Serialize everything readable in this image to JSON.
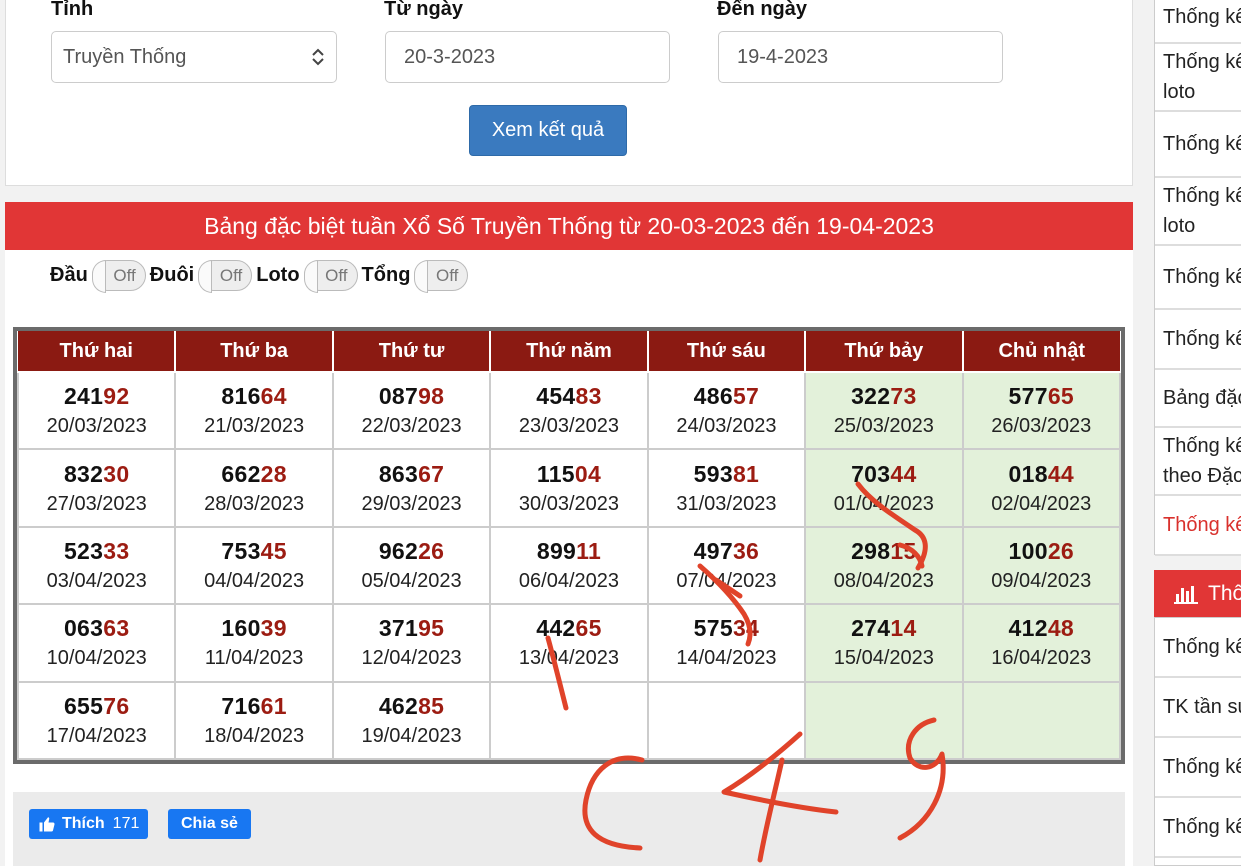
{
  "filter": {
    "province_label": "Tỉnh",
    "province_value": "Truyền Thống",
    "from_label": "Từ ngày",
    "from_value": "20-3-2023",
    "to_label": "Đến ngày",
    "to_value": "19-4-2023",
    "submit_label": "Xem kết quả"
  },
  "panel": {
    "title": "Bảng đặc biệt tuần Xổ Số Truyền Thống từ 20-03-2023 đến 19-04-2023",
    "toggles": [
      {
        "label": "Đầu",
        "state": "Off"
      },
      {
        "label": "Đuôi",
        "state": "Off"
      },
      {
        "label": "Loto",
        "state": "Off"
      },
      {
        "label": "Tổng",
        "state": "Off"
      }
    ]
  },
  "table": {
    "headers": [
      "Thứ hai",
      "Thứ ba",
      "Thứ tư",
      "Thứ năm",
      "Thứ sáu",
      "Thứ bảy",
      "Chủ nhật"
    ],
    "rows": [
      [
        [
          "241",
          "92",
          "20/03/2023"
        ],
        [
          "816",
          "64",
          "21/03/2023"
        ],
        [
          "087",
          "98",
          "22/03/2023"
        ],
        [
          "454",
          "83",
          "23/03/2023"
        ],
        [
          "486",
          "57",
          "24/03/2023"
        ],
        [
          "322",
          "73",
          "25/03/2023"
        ],
        [
          "577",
          "65",
          "26/03/2023"
        ]
      ],
      [
        [
          "832",
          "30",
          "27/03/2023"
        ],
        [
          "662",
          "28",
          "28/03/2023"
        ],
        [
          "863",
          "67",
          "29/03/2023"
        ],
        [
          "115",
          "04",
          "30/03/2023"
        ],
        [
          "593",
          "81",
          "31/03/2023"
        ],
        [
          "703",
          "44",
          "01/04/2023"
        ],
        [
          "018",
          "44",
          "02/04/2023"
        ]
      ],
      [
        [
          "523",
          "33",
          "03/04/2023"
        ],
        [
          "753",
          "45",
          "04/04/2023"
        ],
        [
          "962",
          "26",
          "05/04/2023"
        ],
        [
          "899",
          "11",
          "06/04/2023"
        ],
        [
          "497",
          "36",
          "07/04/2023"
        ],
        [
          "298",
          "15",
          "08/04/2023"
        ],
        [
          "100",
          "26",
          "09/04/2023"
        ]
      ],
      [
        [
          "063",
          "63",
          "10/04/2023"
        ],
        [
          "160",
          "39",
          "11/04/2023"
        ],
        [
          "371",
          "95",
          "12/04/2023"
        ],
        [
          "442",
          "65",
          "13/04/2023"
        ],
        [
          "575",
          "34",
          "14/04/2023"
        ],
        [
          "274",
          "14",
          "15/04/2023"
        ],
        [
          "412",
          "48",
          "16/04/2023"
        ]
      ],
      [
        [
          "655",
          "76",
          "17/04/2023"
        ],
        [
          "716",
          "61",
          "18/04/2023"
        ],
        [
          "462",
          "85",
          "19/04/2023"
        ],
        null,
        null,
        null,
        null
      ]
    ]
  },
  "social": {
    "like_label": "Thích",
    "like_count": "171",
    "share_label": "Chia sẻ"
  },
  "sidebar": {
    "items_top": [
      {
        "lines": [
          "Thống kê"
        ]
      },
      {
        "lines": [
          "Thống kê",
          "loto"
        ]
      },
      {
        "lines": [
          "Thống kê"
        ]
      },
      {
        "lines": [
          "Thống kê",
          "loto"
        ]
      },
      {
        "lines": [
          "Thống kê"
        ]
      },
      {
        "lines": [
          "Thống kê"
        ]
      },
      {
        "lines": [
          "Bảng đặc"
        ]
      },
      {
        "lines": [
          "Thống kê",
          "theo Đặc"
        ]
      },
      {
        "lines": [
          "Thống kê"
        ],
        "active": true
      }
    ],
    "section_title": "Thống kê",
    "items_bottom": [
      {
        "lines": [
          "Thống kê"
        ]
      },
      {
        "lines": [
          "TK tần suất"
        ]
      },
      {
        "lines": [
          "Thống kê"
        ]
      },
      {
        "lines": [
          "Thống kê"
        ]
      }
    ]
  },
  "colors": {
    "title_bar": "#e13636",
    "header_bg": "#8b1a12",
    "highlight_digits": "#9c1c12",
    "weekend_bg": "#e3f1da",
    "button": "#3a7abf",
    "facebook": "#1877f2",
    "handwriting": "#e0432a"
  }
}
